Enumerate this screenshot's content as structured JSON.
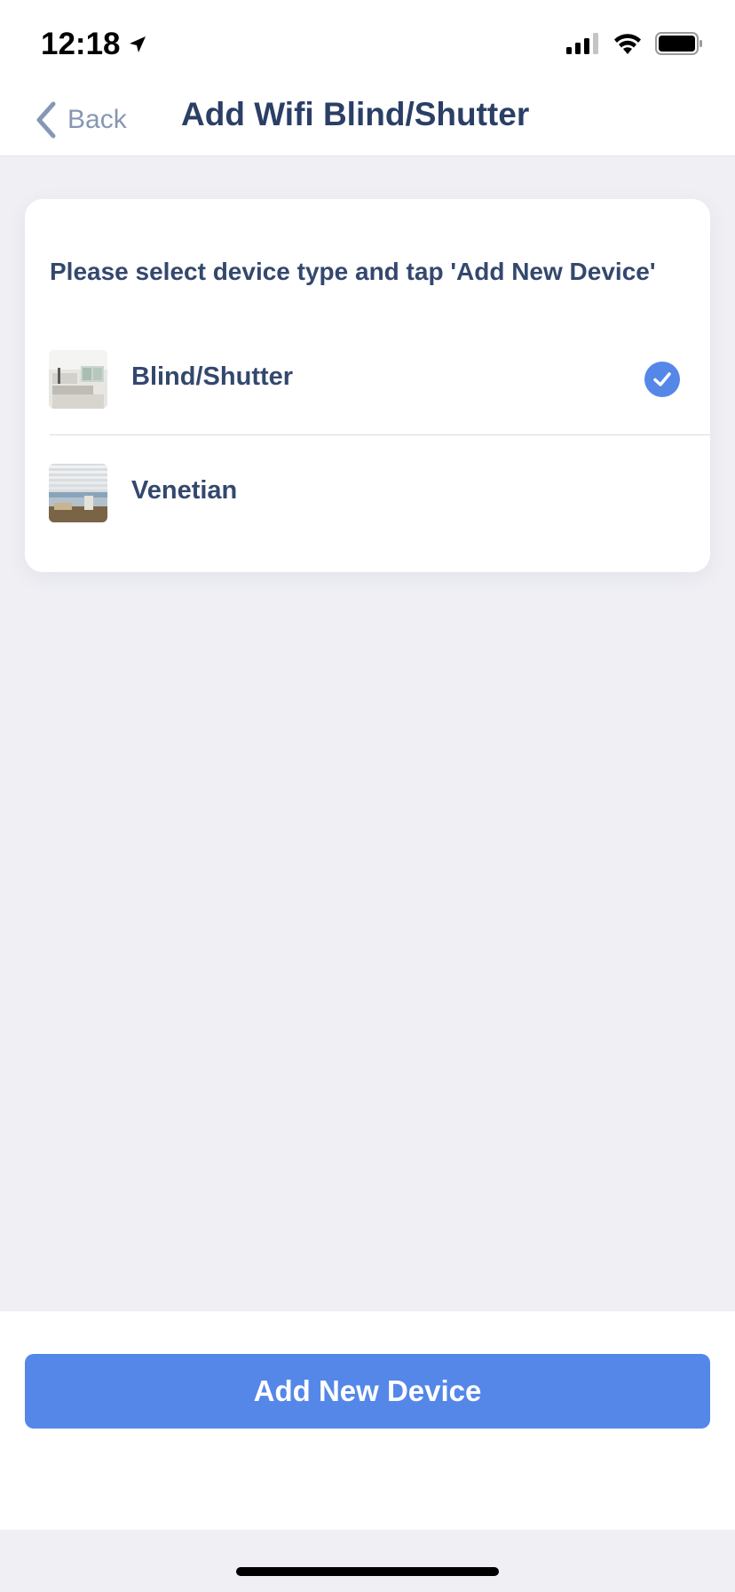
{
  "status_bar": {
    "time": "12:18",
    "location_icon": "location-arrow-icon",
    "signal_icon": "cellular-signal-icon",
    "wifi_icon": "wifi-icon",
    "battery_icon": "battery-icon"
  },
  "nav": {
    "back_label": "Back",
    "back_icon": "chevron-left-icon",
    "title": "Add Wifi Blind/Shutter"
  },
  "card": {
    "instruction": "Please select device type and tap 'Add New Device'",
    "devices": [
      {
        "label": "Blind/Shutter",
        "selected": true,
        "thumbnail": "room-interior-thumbnail"
      },
      {
        "label": "Venetian",
        "selected": false,
        "thumbnail": "venetian-blind-thumbnail"
      }
    ]
  },
  "footer": {
    "add_button_label": "Add New Device"
  },
  "colors": {
    "accent": "#5587e8",
    "title_text": "#2b3f66",
    "back_text": "#8797b3",
    "background": "#efeff4"
  }
}
